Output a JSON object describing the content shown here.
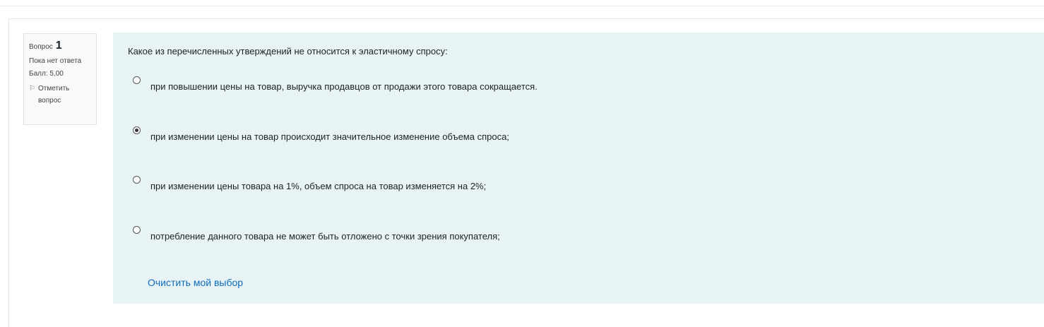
{
  "info": {
    "question_label": "Вопрос",
    "question_number": "1",
    "status": "Пока нет ответа",
    "grade": "Балл: 5,00",
    "flag_line1": "Отметить",
    "flag_line2": "вопрос",
    "flag_icon": "flag-icon"
  },
  "question": {
    "text": "Какое из перечисленных утверждений не относится к эластичному спросу:",
    "options": [
      {
        "label": "при повышении цены на товар, выручка продавцов от продажи этого товара сокращается.",
        "checked": false
      },
      {
        "label": " при изменении цены на товар происходит значительное изменение объема спроса;",
        "checked": true
      },
      {
        "label": "при изменении цены товара на 1%, объем спроса на товар изменяется на 2%;",
        "checked": false
      },
      {
        "label": "потребление данного товара не может быть отложено с точки зрения покупателя;",
        "checked": false
      }
    ],
    "clear_label": "Очистить мой выбор"
  },
  "colors": {
    "content_bg": "#e7f3f5",
    "link": "#0f6cbf"
  }
}
